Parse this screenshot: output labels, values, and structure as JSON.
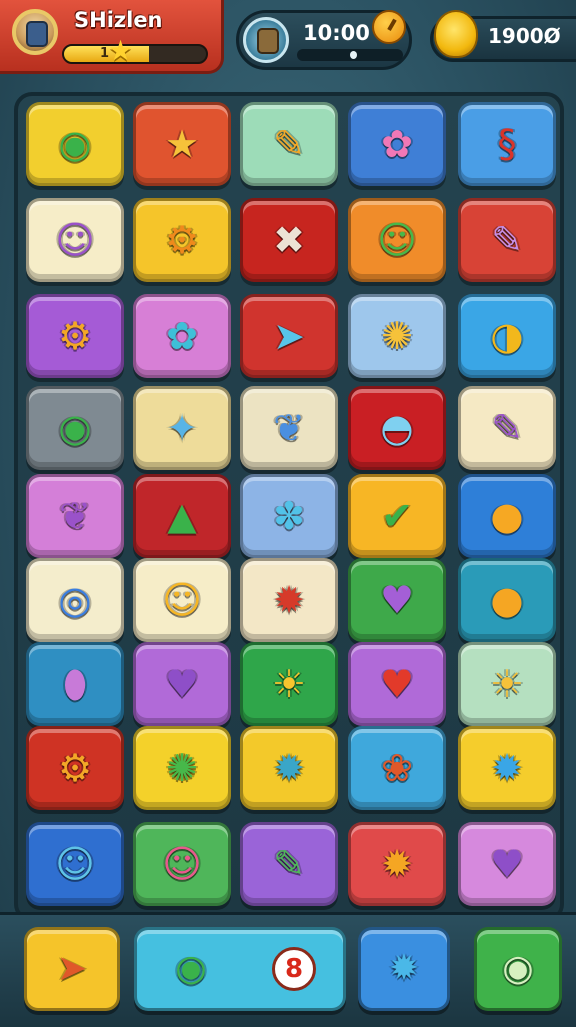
{
  "hud": {
    "player_name": "SHizlen",
    "level": "1",
    "level_progress": 0.6,
    "timer": "10:00",
    "timer_progress": 0.5,
    "coins": "1900Ø"
  },
  "board": {
    "tiles": [
      {
        "bg": "#f2cf2e",
        "fg": "#3ab24a",
        "sym": "◉"
      },
      {
        "bg": "#e0542f",
        "fg": "#f6c23a",
        "sym": "★"
      },
      {
        "bg": "#9ddcb8",
        "fg": "#f3a727",
        "sym": "✎"
      },
      {
        "bg": "#3f7fd6",
        "fg": "#f178b6",
        "sym": "✿"
      },
      {
        "bg": "#4a9ee6",
        "fg": "#d9342a",
        "sym": "§"
      },
      {
        "bg": "#f6edc8",
        "fg": "#9a52c9",
        "sym": "☺"
      },
      {
        "bg": "#f5c52a",
        "fg": "#f08a1c",
        "sym": "⚙"
      },
      {
        "bg": "#c7251f",
        "fg": "#ece2d4",
        "sym": "✖"
      },
      {
        "bg": "#f08c2a",
        "fg": "#47b84a",
        "sym": "☺"
      },
      {
        "bg": "#d84336",
        "fg": "#c58fe6",
        "sym": "✎"
      },
      {
        "bg": "#a55bd6",
        "fg": "#f3a727",
        "sym": "⚙"
      },
      {
        "bg": "#d77fd6",
        "fg": "#3ec0d8",
        "sym": "✿"
      },
      {
        "bg": "#d0342e",
        "fg": "#57c5e9",
        "sym": "➤"
      },
      {
        "bg": "#9ec7ec",
        "fg": "#f6c23a",
        "sym": "✺"
      },
      {
        "bg": "#3aa6e6",
        "fg": "#f2b81c",
        "sym": "◑"
      },
      {
        "bg": "#7f8a92",
        "fg": "#3ab24a",
        "sym": "◉"
      },
      {
        "bg": "#eedc9a",
        "fg": "#58b4e6",
        "sym": "✦"
      },
      {
        "bg": "#ece3c2",
        "fg": "#4a8fe0",
        "sym": "❦"
      },
      {
        "bg": "#c91f24",
        "fg": "#7fd0f0",
        "sym": "◓"
      },
      {
        "bg": "#f5e9c4",
        "fg": "#9a52c9",
        "sym": "✎"
      },
      {
        "bg": "#d47fd8",
        "fg": "#9a52c9",
        "sym": "❦"
      },
      {
        "bg": "#c0262a",
        "fg": "#3ab24a",
        "sym": "▲"
      },
      {
        "bg": "#8db4e6",
        "fg": "#52c2e8",
        "sym": "✽"
      },
      {
        "bg": "#f7b625",
        "fg": "#3ab24a",
        "sym": "✔"
      },
      {
        "bg": "#2e7fd8",
        "fg": "#f6a823",
        "sym": "●"
      },
      {
        "bg": "#f4edcc",
        "fg": "#3a7ee0",
        "sym": "◎"
      },
      {
        "bg": "#f6edc8",
        "fg": "#f6b625",
        "sym": "☺"
      },
      {
        "bg": "#f3e7c6",
        "fg": "#d63a2a",
        "sym": "✹"
      },
      {
        "bg": "#3ea94a",
        "fg": "#a45fd6",
        "sym": "♥"
      },
      {
        "bg": "#2a9bb8",
        "fg": "#f5a623",
        "sym": "●"
      },
      {
        "bg": "#2f8fc2",
        "fg": "#c87ad8",
        "sym": "⬮"
      },
      {
        "bg": "#b16ad8",
        "fg": "#8e4fc8",
        "sym": "♥"
      },
      {
        "bg": "#2fa64a",
        "fg": "#f7c52e",
        "sym": "☀"
      },
      {
        "bg": "#b06ad8",
        "fg": "#e23a2a",
        "sym": "♥"
      },
      {
        "bg": "#b5e0c0",
        "fg": "#f6c23a",
        "sym": "☀"
      },
      {
        "bg": "#cf3324",
        "fg": "#f3a727",
        "sym": "⚙"
      },
      {
        "bg": "#f4d12a",
        "fg": "#47b84a",
        "sym": "✺"
      },
      {
        "bg": "#f3c92a",
        "fg": "#3aa6c8",
        "sym": "✹"
      },
      {
        "bg": "#3fa8dc",
        "fg": "#e0582a",
        "sym": "❀"
      },
      {
        "bg": "#f5cd2c",
        "fg": "#3aa6e6",
        "sym": "✹"
      },
      {
        "bg": "#2f6fd0",
        "fg": "#5fc3e6",
        "sym": "☺"
      },
      {
        "bg": "#4fb65a",
        "fg": "#e85a8c",
        "sym": "☺"
      },
      {
        "bg": "#9a64d8",
        "fg": "#4fb65a",
        "sym": "✎"
      },
      {
        "bg": "#e04a4a",
        "fg": "#f5a623",
        "sym": "✹"
      },
      {
        "bg": "#d689dd",
        "fg": "#8e4fc8",
        "sym": "♥"
      }
    ]
  },
  "bottom": {
    "left_button": {
      "bg": "#f5c42a",
      "fg": "#e0582a",
      "sym": "➤"
    },
    "center_bar": {
      "bg": "#45c0e0",
      "fg": "#3ab24a",
      "sym": "◉"
    },
    "badge_value": "8",
    "sun_button": {
      "bg": "#3a8fe0",
      "fg": "#4ab8e8",
      "sym": "✹"
    },
    "right_button": {
      "bg": "#3fb24a",
      "fg": "#d6f0c0",
      "sym": "◉"
    }
  }
}
